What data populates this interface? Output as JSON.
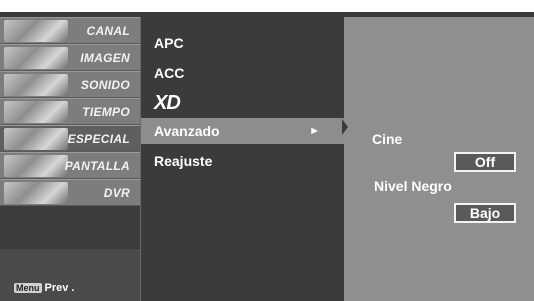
{
  "categories": [
    {
      "label": "CANAL",
      "icon": "canal-icon"
    },
    {
      "label": "IMAGEN",
      "icon": "imagen-icon"
    },
    {
      "label": "SONIDO",
      "icon": "sonido-icon"
    },
    {
      "label": "TIEMPO",
      "icon": "tiempo-icon"
    },
    {
      "label": "ESPECIAL",
      "icon": "especial-icon",
      "selected": true
    },
    {
      "label": "PANTALLA",
      "icon": "pantalla-icon"
    },
    {
      "label": "DVR",
      "icon": "dvr-icon"
    }
  ],
  "footer": {
    "key_label": "Menu",
    "text": "Prev ."
  },
  "menu": {
    "items": [
      {
        "label": "APC"
      },
      {
        "label": "ACC"
      },
      {
        "label": "XD"
      },
      {
        "label": "Avanzado",
        "selected": true,
        "arrow": "►"
      },
      {
        "label": "Reajuste"
      }
    ]
  },
  "submenu": {
    "cine_label": "Cine",
    "cine_value": "Off",
    "nivel_negro_label": "Nivel Negro",
    "nivel_negro_value": "Bajo"
  },
  "colors": {
    "background": "#3b3b3b",
    "selected": "#8d8d8d",
    "submenu": "#8f8f8f"
  }
}
